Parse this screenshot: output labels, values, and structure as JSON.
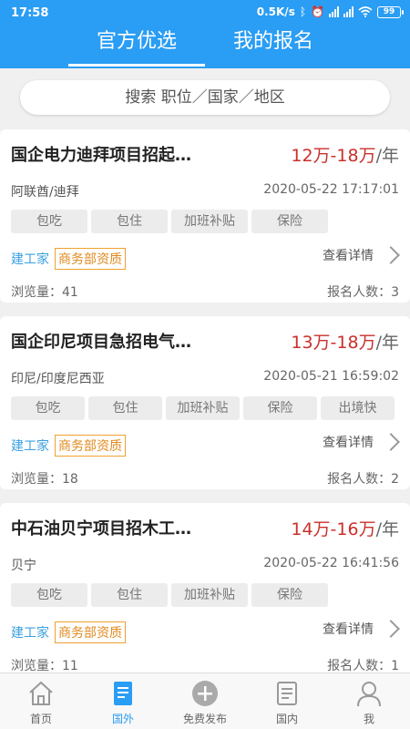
{
  "status": {
    "time": "17:58",
    "speed": "0.5K/s",
    "battery": "99"
  },
  "tabs": [
    {
      "label": "官方优选"
    },
    {
      "label": "我的报名"
    }
  ],
  "search": {
    "placeholder": "搜索 职位／国家／地区"
  },
  "cards": [
    {
      "title": "国企电力迪拜项目招起…",
      "salary": "12万-18万",
      "unit": "/年",
      "location": "阿联酋/迪拜",
      "date": "2020-05-22 17:17:01",
      "tags": [
        "包吃",
        "包住",
        "加班补贴",
        "保险"
      ],
      "company": "建工家",
      "qualification": "商务部资质",
      "detail": "查看详情",
      "views": "浏览量：41",
      "signups": "报名人数：3"
    },
    {
      "title": "国企印尼项目急招电气…",
      "salary": "13万-18万",
      "unit": "/年",
      "location": "印尼/印度尼西亚",
      "date": "2020-05-21 16:59:02",
      "tags": [
        "包吃",
        "包住",
        "加班补贴",
        "保险",
        "出境快"
      ],
      "company": "建工家",
      "qualification": "商务部资质",
      "detail": "查看详情",
      "views": "浏览量：18",
      "signups": "报名人数：2"
    },
    {
      "title": "中石油贝宁项目招木工…",
      "salary": "14万-16万",
      "unit": "/年",
      "location": "贝宁",
      "date": "2020-05-22 16:41:56",
      "tags": [
        "包吃",
        "包住",
        "加班补贴",
        "保险"
      ],
      "company": "建工家",
      "qualification": "商务部资质",
      "detail": "查看详情",
      "views": "浏览量：11",
      "signups": "报名人数：1"
    }
  ],
  "nav": [
    {
      "label": "首页",
      "icon": "home-icon"
    },
    {
      "label": "国外",
      "icon": "document-icon"
    },
    {
      "label": "免费发布",
      "icon": "plus-circle-icon"
    },
    {
      "label": "国内",
      "icon": "list-icon"
    },
    {
      "label": "我",
      "icon": "person-icon"
    }
  ],
  "colors": {
    "primary": "#2a9df4",
    "salary": "#c9302c",
    "company": "#3aa0e0",
    "qualification": "#e08a1e"
  }
}
